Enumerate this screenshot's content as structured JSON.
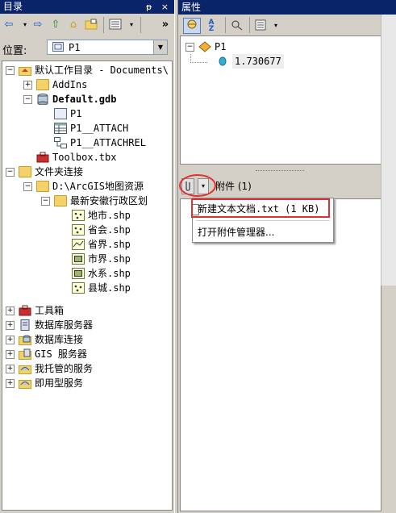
{
  "left_panel": {
    "title": "目录",
    "title_buttons": "ᵽ ×",
    "toolbar_more": "»",
    "location_label": "位置:",
    "location_value": "P1",
    "tree": {
      "default_workspace": "默认工作目录 - Documents\\",
      "addins": "AddIns",
      "default_gdb": "Default.gdb",
      "p1": "P1",
      "p1_attach": "P1__ATTACH",
      "p1_attachrel": "P1__ATTACHREL",
      "toolbox": "Toolbox.tbx",
      "folder_connections": "文件夹连接",
      "d_drive": "D:\\ArcGIS地图资源",
      "anhui": "最新安徽行政区划",
      "city": "地市.shp",
      "province": "省会.shp",
      "prov_border": "省界.shp",
      "city_border": "市界.shp",
      "water": "水系.shp",
      "county": "县城.shp",
      "toolboxes": "工具箱",
      "db_servers": "数据库服务器",
      "db_connections": "数据库连接",
      "gis_servers": "GIS 服务器",
      "my_hosted": "我托管的服务",
      "ready_services": "即用型服务"
    }
  },
  "right_panel": {
    "title": "属性",
    "tree_root": "P1",
    "tree_value": "1.730677",
    "attachments_label": "附件 (1)",
    "menu": {
      "item_file": "新建文本文档.txt (1 KB)",
      "item_manager": "打开附件管理器..."
    }
  },
  "colors": {
    "titlebar": "#0a246a",
    "highlight_red": "#e03030",
    "panel_bg": "#d4d0c8"
  }
}
